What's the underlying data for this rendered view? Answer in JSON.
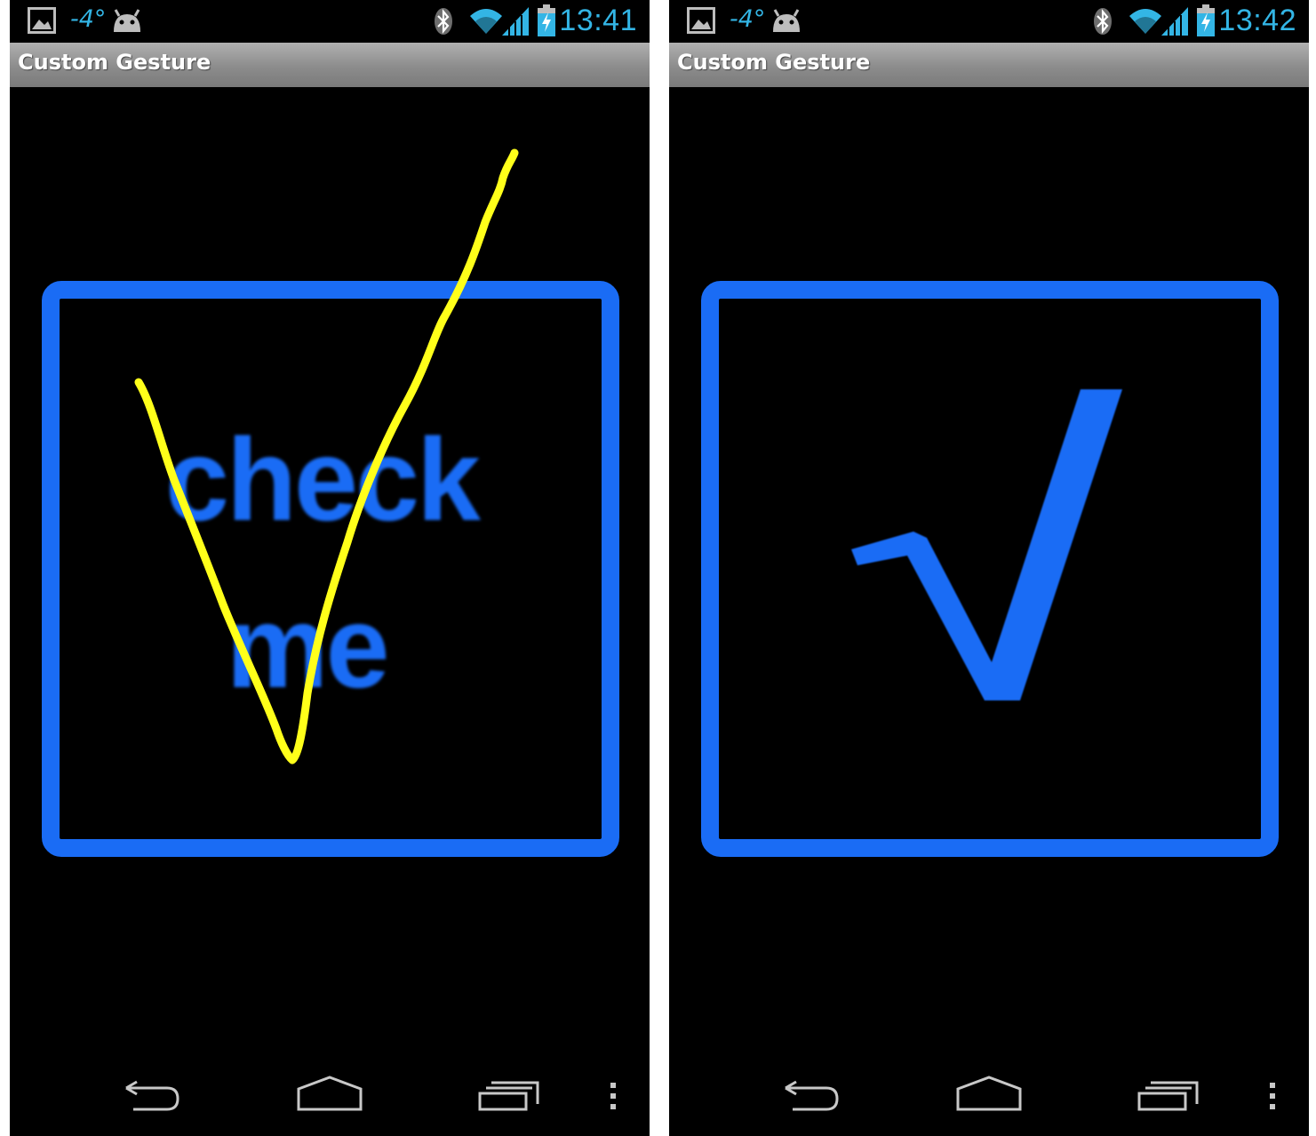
{
  "screens": [
    {
      "status_bar": {
        "temperature": "-4°",
        "time": "13:41",
        "icons": [
          "picture-icon",
          "android-icon",
          "bluetooth-icon",
          "wifi-icon",
          "signal-icon",
          "battery-charging-icon"
        ]
      },
      "action_bar": {
        "title": "Custom Gesture"
      },
      "content": {
        "box_line1": "check",
        "box_line2": "me",
        "gesture_stroke": "yellow-checkmark-stroke"
      },
      "nav_bar": {
        "icons": [
          "back-icon",
          "home-icon",
          "recents-icon",
          "menu-icon"
        ]
      }
    },
    {
      "status_bar": {
        "temperature": "-4°",
        "time": "13:42",
        "icons": [
          "picture-icon",
          "android-icon",
          "bluetooth-icon",
          "wifi-icon",
          "signal-icon",
          "battery-charging-icon"
        ]
      },
      "action_bar": {
        "title": "Custom Gesture"
      },
      "content": {
        "check_glyph": "checkmark-icon"
      },
      "nav_bar": {
        "icons": [
          "back-icon",
          "home-icon",
          "recents-icon",
          "menu-icon"
        ]
      }
    }
  ],
  "colors": {
    "accent_blue": "#1a6cf5",
    "status_blue": "#33b5e5",
    "stroke_yellow": "#ffff1a",
    "action_bar_gray": "#8c8c8c",
    "background": "#000000"
  }
}
